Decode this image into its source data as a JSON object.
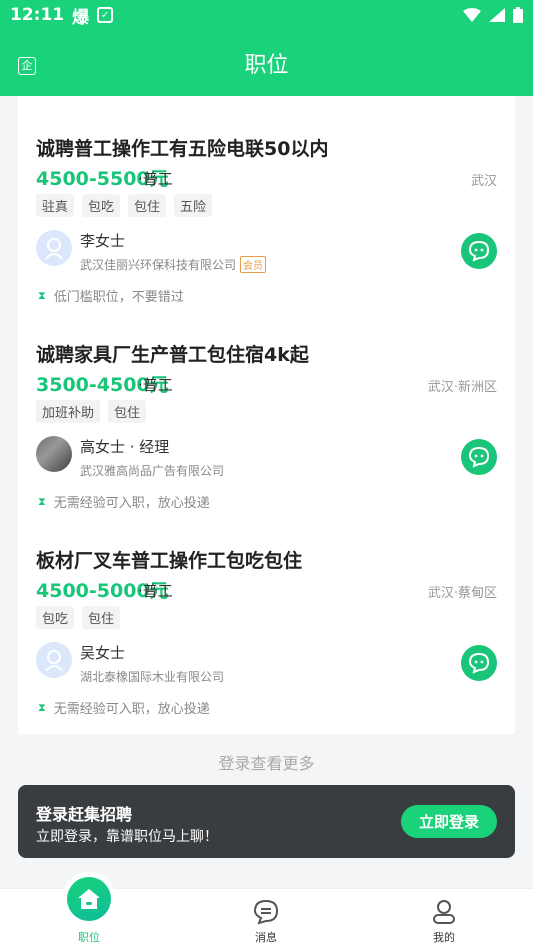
{
  "status": {
    "time": "12:11",
    "badge": "爆"
  },
  "header": {
    "title": "职位",
    "left_icon_label": "企"
  },
  "jobs": [
    {
      "title": "诚聘普工操作工有五险电联50以内",
      "salary": "4500-5500元",
      "category": "·普工",
      "location": "武汉",
      "tags": [
        "驻真",
        "包吃",
        "包住",
        "五险"
      ],
      "recruiter": "李女士",
      "company": "武汉佳丽兴环保科技有限公司",
      "vip": "会员",
      "hint": "低门槛职位，不要错过"
    },
    {
      "title": "诚聘家具厂生产普工包住宿4k起",
      "salary": "3500-4500元",
      "category": "·普工",
      "location": "武汉·新洲区",
      "tags": [
        "加班补助",
        "包住"
      ],
      "recruiter": "高女士 · 经理",
      "company": "武汉雅高尚品广告有限公司",
      "hint": "无需经验可入职，放心投递"
    },
    {
      "title": "板材厂叉车普工操作工包吃包住",
      "salary": "4500-5000元",
      "category": "·普工",
      "location": "武汉·蔡甸区",
      "tags": [
        "包吃",
        "包住"
      ],
      "recruiter": "吴女士",
      "company": "湖北泰橡国际木业有限公司",
      "hint": "无需经验可入职，放心投递"
    }
  ],
  "more": "登录查看更多",
  "login": {
    "title": "登录赶集招聘",
    "subtitle": "立即登录，靠谱职位马上聊！",
    "button": "立即登录"
  },
  "tabs": [
    {
      "label": "职位",
      "icon": "home-icon"
    },
    {
      "label": "消息",
      "icon": "message-icon"
    },
    {
      "label": "我的",
      "icon": "profile-icon"
    }
  ],
  "colors": {
    "brand": "#19d27a",
    "salary": "#19c578",
    "vip": "#e89b4a"
  }
}
